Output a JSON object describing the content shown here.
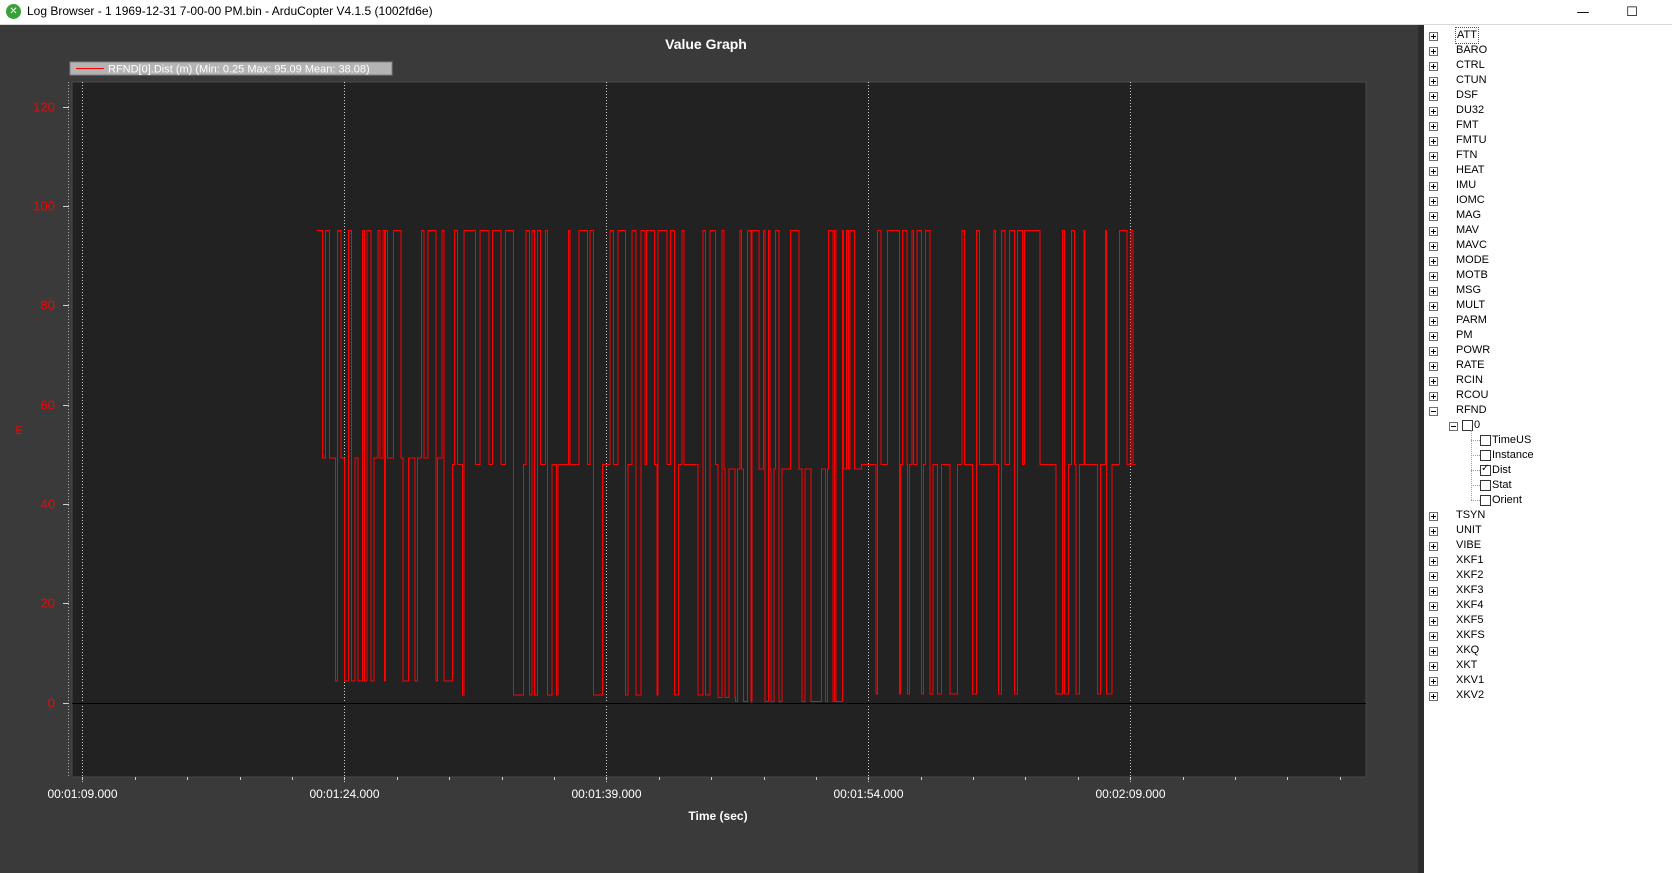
{
  "window": {
    "title": "Log Browser - 1 1969-12-31 7-00-00 PM.bin - ArduCopter V4.1.5 (1002fd6e)",
    "minimize_glyph": "—",
    "maximize_glyph": "☐"
  },
  "chart_data": {
    "type": "line",
    "title": "Value Graph",
    "xlabel": "Time (sec)",
    "ylabel": "m",
    "background": "#222222",
    "line_color": "#ff0000",
    "ylim": [
      -15,
      125
    ],
    "yticks": [
      0,
      20,
      40,
      60,
      80,
      100,
      120
    ],
    "xtick_labels": [
      "00:01:09.000",
      "00:01:24.000",
      "00:01:39.000",
      "00:01:54.000",
      "00:02:09.000"
    ],
    "xlim_seconds": [
      68.4,
      142.5
    ],
    "xtick_seconds": [
      69,
      84,
      99,
      114,
      129
    ],
    "grid": "vertical dotted at x ticks",
    "legend": {
      "label": "RFND[0].Dist (m)  (Min: 0.25 Max: 95.09 Mean: 38.08)",
      "placement": "top-left"
    },
    "series": [
      {
        "name": "RFND[0].Dist (m)",
        "description_segments": [
          {
            "x_start": 82.4,
            "x_end": 89.7,
            "low": 4.3,
            "mid": 49.3,
            "high": 95.09
          },
          {
            "x_start": 89.7,
            "x_end": 90.5,
            "low": 4.3,
            "mid": 48.0,
            "high": 95.09
          },
          {
            "x_start": 90.5,
            "x_end": 105.4,
            "low": 1.5,
            "mid": 48.0,
            "high": 95.09
          },
          {
            "x_start": 105.4,
            "x_end": 106.4,
            "low": 1.0,
            "mid": 47.0,
            "high": 95.09
          },
          {
            "x_start": 106.4,
            "x_end": 113.6,
            "low": 0.25,
            "mid": 47.0,
            "high": 95.09
          },
          {
            "x_start": 113.6,
            "x_end": 129.3,
            "low": 1.7,
            "mid": 48.0,
            "high": 95.09
          }
        ]
      }
    ]
  },
  "tree": {
    "items_before": [
      "ATT",
      "BARO",
      "CTRL",
      "CTUN",
      "DSF",
      "DU32",
      "FMT",
      "FMTU",
      "FTN",
      "HEAT",
      "IMU",
      "IOMC",
      "MAG",
      "MAV",
      "MAVC",
      "MODE",
      "MOTB",
      "MSG",
      "MULT",
      "PARM",
      "PM",
      "POWR",
      "RATE",
      "RCIN",
      "RCOU"
    ],
    "expanded": {
      "label": "RFND",
      "instance": "0",
      "fields": [
        {
          "label": "TimeUS",
          "checked": false
        },
        {
          "label": "Instance",
          "checked": false
        },
        {
          "label": "Dist",
          "checked": true
        },
        {
          "label": "Stat",
          "checked": false
        },
        {
          "label": "Orient",
          "checked": false
        }
      ]
    },
    "items_after": [
      "TSYN",
      "UNIT",
      "VIBE",
      "XKF1",
      "XKF2",
      "XKF3",
      "XKF4",
      "XKF5",
      "XKFS",
      "XKQ",
      "XKT",
      "XKV1",
      "XKV2"
    ],
    "check_glyph": "✓"
  }
}
